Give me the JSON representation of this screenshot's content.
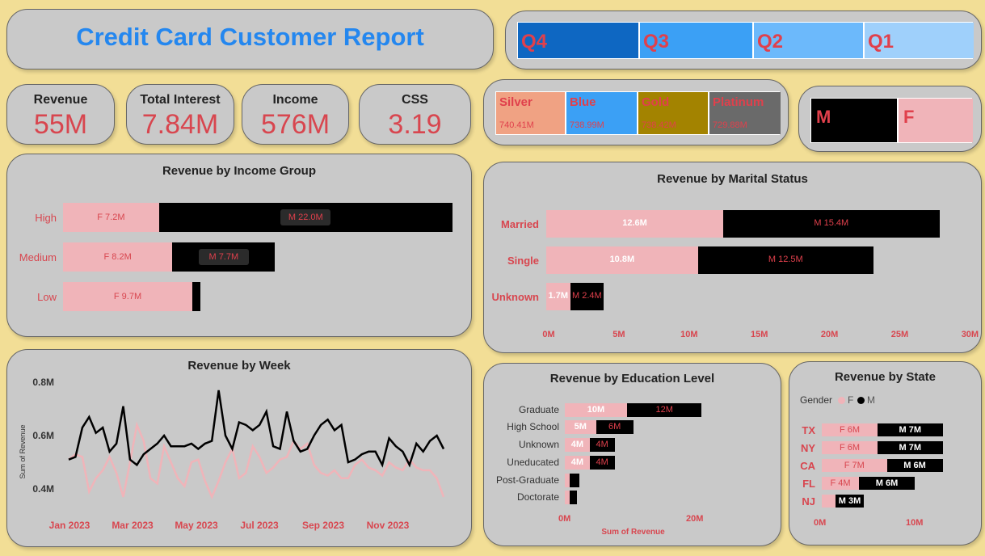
{
  "header": {
    "title": "Credit Card Customer Report"
  },
  "quarters": [
    {
      "label": "Q4",
      "color": "#0e67c2"
    },
    {
      "label": "Q3",
      "color": "#3ba0f5"
    },
    {
      "label": "Q2",
      "color": "#6cb9fb"
    },
    {
      "label": "Q1",
      "color": "#9fd0fb"
    }
  ],
  "kpis": [
    {
      "label": "Revenue",
      "value": "55M"
    },
    {
      "label": "Total Interest",
      "value": "7.84M"
    },
    {
      "label": "Income",
      "value": "576M"
    },
    {
      "label": "CSS",
      "value": "3.19"
    }
  ],
  "card_categories": [
    {
      "name": "Silver",
      "value": "740.41M",
      "color": "#f0a283"
    },
    {
      "name": "Blue",
      "value": "738.99M",
      "color": "#3ba0f5"
    },
    {
      "name": "Gold",
      "value": "738.42M",
      "color": "#a38300"
    },
    {
      "name": "Platinum",
      "value": "729.88M",
      "color": "#6a6a6a"
    }
  ],
  "gender_filter": [
    {
      "label": "M",
      "color": "#000000"
    },
    {
      "label": "F",
      "color": "#f0b4b9"
    }
  ],
  "chart_data": [
    {
      "type": "bar",
      "title": "Revenue by Income Group",
      "categories": [
        "High",
        "Medium",
        "Low"
      ],
      "series": [
        {
          "name": "F",
          "values": [
            7.2,
            8.2,
            9.7
          ],
          "labels": [
            "F 7.2M",
            "F 8.2M",
            "F 9.7M"
          ],
          "color": "#f0b4b9"
        },
        {
          "name": "M",
          "values": [
            22.0,
            7.7,
            0.6
          ],
          "labels": [
            "M 22.0M",
            "M 7.7M",
            ""
          ],
          "color": "#000000"
        }
      ]
    },
    {
      "type": "bar",
      "title": "Revenue by Marital Status",
      "categories": [
        "Married",
        "Single",
        "Unknown"
      ],
      "series": [
        {
          "name": "F",
          "values": [
            12.6,
            10.8,
            1.7
          ],
          "labels": [
            "12.6M",
            "10.8M",
            "1.7M"
          ],
          "color": "#f0b4b9"
        },
        {
          "name": "M",
          "values": [
            15.4,
            12.5,
            2.4
          ],
          "labels": [
            "M 15.4M",
            "M 12.5M",
            "M 2.4M"
          ],
          "color": "#000000"
        }
      ],
      "ticks": [
        "0M",
        "5M",
        "10M",
        "15M",
        "20M",
        "25M",
        "30M"
      ],
      "xlim": [
        0,
        30
      ]
    },
    {
      "type": "line",
      "title": "Revenue by Week",
      "ylabel": "Sum of Revenue",
      "yticks": [
        "0.8M",
        "0.6M",
        "0.4M"
      ],
      "ylim": [
        0.4,
        0.8
      ],
      "xticks": [
        "Jan 2023",
        "Mar 2023",
        "May 2023",
        "Jul 2023",
        "Sep 2023",
        "Nov 2023"
      ],
      "series": [
        {
          "name": "M",
          "color": "#000000",
          "values": [
            0.51,
            0.52,
            0.63,
            0.67,
            0.61,
            0.63,
            0.54,
            0.57,
            0.71,
            0.51,
            0.49,
            0.53,
            0.55,
            0.57,
            0.6,
            0.56,
            0.56,
            0.56,
            0.57,
            0.55,
            0.57,
            0.58,
            0.77,
            0.6,
            0.55,
            0.65,
            0.64,
            0.62,
            0.64,
            0.69,
            0.56,
            0.55,
            0.69,
            0.58,
            0.54,
            0.55,
            0.6,
            0.64,
            0.66,
            0.62,
            0.64,
            0.5,
            0.51,
            0.53,
            0.54,
            0.54,
            0.49,
            0.59,
            0.56,
            0.54,
            0.49,
            0.57,
            0.54,
            0.58,
            0.6,
            0.55
          ]
        },
        {
          "name": "F",
          "color": "#f0b4b9",
          "values": [
            0.51,
            0.53,
            0.52,
            0.39,
            0.44,
            0.47,
            0.52,
            0.46,
            0.37,
            0.5,
            0.64,
            0.58,
            0.44,
            0.42,
            0.56,
            0.5,
            0.44,
            0.41,
            0.5,
            0.51,
            0.43,
            0.37,
            0.43,
            0.5,
            0.55,
            0.44,
            0.46,
            0.56,
            0.52,
            0.46,
            0.48,
            0.51,
            0.52,
            0.58,
            0.55,
            0.57,
            0.49,
            0.46,
            0.45,
            0.47,
            0.44,
            0.44,
            0.49,
            0.51,
            0.48,
            0.47,
            0.45,
            0.5,
            0.48,
            0.47,
            0.51,
            0.48,
            0.47,
            0.47,
            0.44,
            0.37
          ]
        }
      ]
    },
    {
      "type": "bar",
      "title": "Revenue by Education Level",
      "categories": [
        "Graduate",
        "High School",
        "Unknown",
        "Uneducated",
        "Post-Graduate",
        "Doctorate"
      ],
      "series": [
        {
          "name": "F",
          "values": [
            10,
            5,
            4,
            4,
            0.8,
            0.8
          ],
          "labels": [
            "10M",
            "5M",
            "4M",
            "4M",
            "",
            ""
          ],
          "color": "#f0b4b9"
        },
        {
          "name": "M",
          "values": [
            12,
            6,
            4,
            4,
            1.6,
            1.2
          ],
          "labels": [
            "12M",
            "6M",
            "4M",
            "4M",
            "",
            ""
          ],
          "color": "#000000"
        }
      ],
      "ticks": [
        "0M",
        "20M"
      ],
      "xlabel": "Sum of Revenue",
      "xlim": [
        0,
        22
      ]
    },
    {
      "type": "bar",
      "title": "Revenue by State",
      "legend_title": "Gender",
      "legend": [
        "F",
        "M"
      ],
      "categories": [
        "TX",
        "NY",
        "CA",
        "FL",
        "NJ"
      ],
      "series": [
        {
          "name": "F",
          "values": [
            6,
            6,
            7,
            4,
            1.5
          ],
          "labels": [
            "F 6M",
            "F 6M",
            "F 7M",
            "F 4M",
            ""
          ],
          "color": "#f0b4b9"
        },
        {
          "name": "M",
          "values": [
            7,
            7,
            6,
            6,
            3
          ],
          "labels": [
            "M 7M",
            "M 7M",
            "M 6M",
            "M 6M",
            "M 3M"
          ],
          "color": "#000000"
        }
      ],
      "ticks": [
        "0M",
        "10M"
      ],
      "xlim": [
        0,
        14
      ]
    }
  ]
}
